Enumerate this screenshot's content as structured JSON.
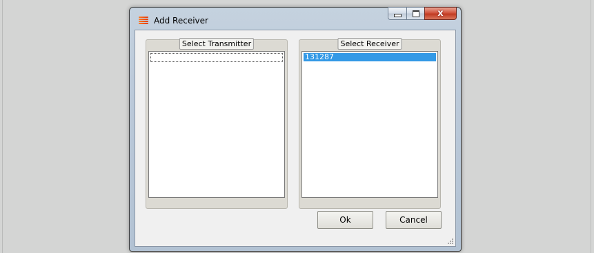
{
  "window": {
    "title": "Add Receiver",
    "controls": {
      "close_glyph": "x",
      "icon": "app-icon"
    }
  },
  "transmitter_group": {
    "label": "Select Transmitter",
    "items": []
  },
  "receiver_group": {
    "label": "Select Receiver",
    "items": [
      "131287"
    ],
    "selected_index": 0
  },
  "buttons": {
    "ok": "Ok",
    "cancel": "Cancel"
  },
  "colors": {
    "selection": "#3399e6",
    "background": "#d4d5d4"
  }
}
